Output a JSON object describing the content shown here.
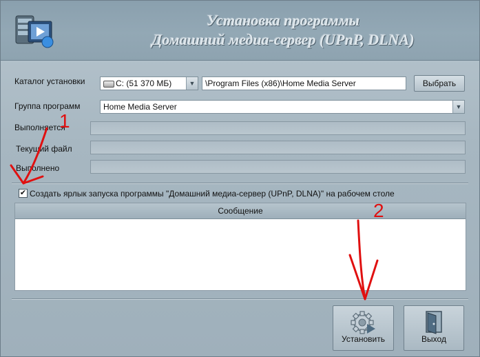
{
  "header": {
    "title_line1": "Установка программы",
    "title_line2": "Домашний медиа-сервер (UPnP, DLNA)"
  },
  "form": {
    "install_dir_label": "Каталог установки",
    "drive_value": "C: (51 370 МБ)",
    "path_value": "\\Program Files (x86)\\Home Media Server",
    "browse_button": "Выбрать",
    "program_group_label": "Группа программ",
    "program_group_value": "Home Media Server",
    "running_label": "Выполняется",
    "current_file_label": "Текущий файл",
    "completed_label": "Выполнено"
  },
  "shortcut": {
    "checked": true,
    "label": "Создать ярлык запуска программы \"Домашний медиа-сервер (UPnP, DLNA)\" на рабочем столе"
  },
  "messages": {
    "column_header": "Сообщение",
    "rows": []
  },
  "buttons": {
    "install": "Установить",
    "exit": "Выход"
  },
  "annotations": {
    "marker1": "1",
    "marker2": "2",
    "color": "#e01010"
  },
  "icons": {
    "logo": "media-server-logo-icon",
    "install": "gear-play-icon",
    "exit": "exit-door-icon",
    "dropdown": "chevron-down-icon",
    "drive": "hard-drive-icon"
  }
}
